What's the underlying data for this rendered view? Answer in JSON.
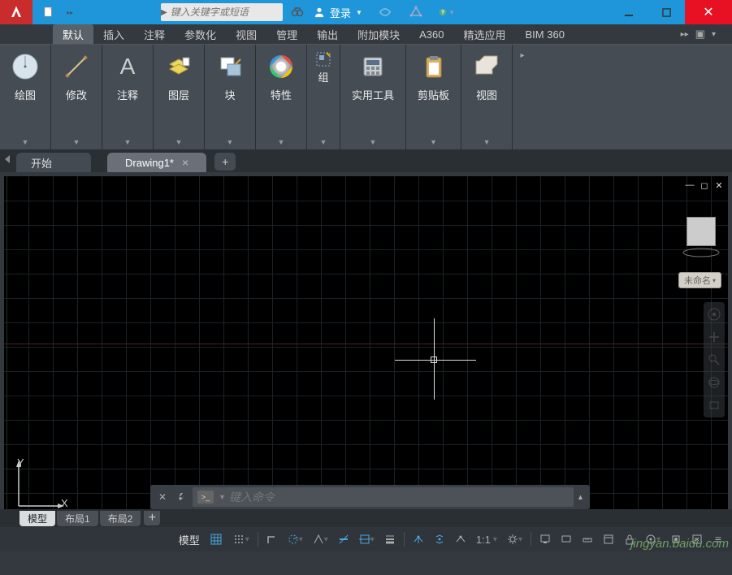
{
  "titlebar": {
    "search_placeholder": "键入关键字或短语",
    "login_text": "登录"
  },
  "menu": {
    "items": [
      "默认",
      "插入",
      "注释",
      "参数化",
      "视图",
      "管理",
      "输出",
      "附加模块",
      "A360",
      "精选应用",
      "BIM 360"
    ]
  },
  "ribbon": {
    "panels": [
      {
        "label": "绘图"
      },
      {
        "label": "修改"
      },
      {
        "label": "注释"
      },
      {
        "label": "图层"
      },
      {
        "label": "块"
      },
      {
        "label": "特性"
      },
      {
        "label": "组"
      },
      {
        "label": "实用工具"
      },
      {
        "label": "剪贴板"
      },
      {
        "label": "视图"
      }
    ]
  },
  "docTabs": {
    "start": "开始",
    "active": "Drawing1*"
  },
  "viewcube": {
    "unnamed": "未命名"
  },
  "ucs": {
    "x": "X",
    "y": "Y"
  },
  "cmd": {
    "placeholder": "键入命令"
  },
  "layoutTabs": {
    "items": [
      "模型",
      "布局1",
      "布局2"
    ]
  },
  "statusbar": {
    "model": "模型",
    "scale": "1:1"
  },
  "watermark": "jingyan.baidu.com",
  "colors": {
    "accent": "#1e96d9",
    "danger": "#e81123"
  }
}
